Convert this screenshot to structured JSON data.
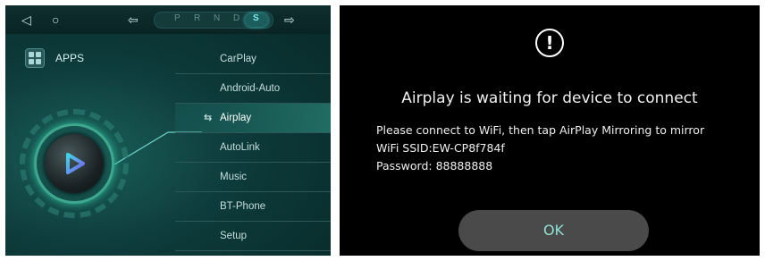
{
  "left_panel": {
    "gear_selector": {
      "gears": [
        "P",
        "R",
        "N",
        "D",
        "S"
      ],
      "active": "S"
    },
    "icons": {
      "back": "back-triangle-icon",
      "home": "home-circle-icon",
      "prev": "arrow-left-icon",
      "next": "arrow-right-icon"
    },
    "apps_label": "APPS",
    "menu": [
      {
        "label": "CarPlay",
        "selected": false
      },
      {
        "label": "Android-Auto",
        "selected": false
      },
      {
        "label": "Airplay",
        "selected": true
      },
      {
        "label": "AutoLink",
        "selected": false
      },
      {
        "label": "Music",
        "selected": false
      },
      {
        "label": "BT-Phone",
        "selected": false
      },
      {
        "label": "Setup",
        "selected": false
      }
    ],
    "colors": {
      "accent": "#3ea88e",
      "background": "#0d3a3a"
    }
  },
  "dialog": {
    "title": "Airplay is waiting for device to connect",
    "lines": [
      "Please connect to WiFi, then tap AirPlay Mirroring to mirror",
      "WiFi SSID:EW-CP8f784f",
      "Password: 88888888"
    ],
    "ok_label": "OK",
    "colors": {
      "ok_text": "#8ee0d4",
      "button": "#4a4a4a"
    }
  }
}
